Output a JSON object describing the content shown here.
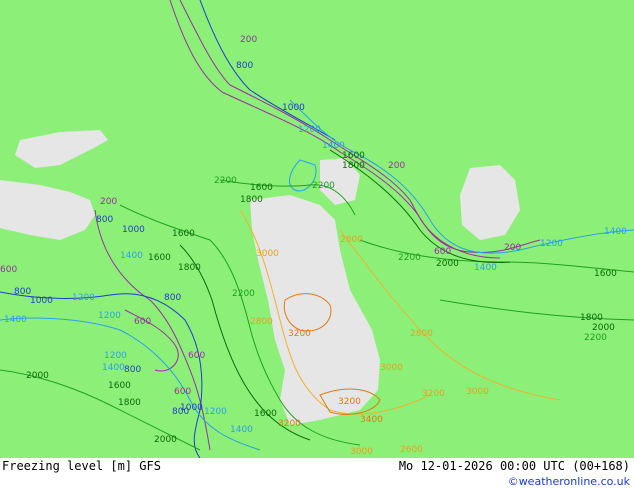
{
  "footer": {
    "title": "Freezing level [m] GFS",
    "datetime": "Mo 12-01-2026 00:00 UTC (00+168)",
    "credit": "©weatheronline.co.uk"
  },
  "colors": {
    "sea": "#8cf078",
    "land": "#e6e6e6",
    "low_contours": "#9a2fa0",
    "mid_contours": "#2aa0e8",
    "green_contours": "#1ea01e",
    "high_contours": "#f0b030"
  },
  "contour_labels": [
    {
      "text": "200",
      "color": "#9a2fa0"
    },
    {
      "text": "600",
      "color": "#9a2fa0"
    },
    {
      "text": "800",
      "color": "#1f3cd0"
    },
    {
      "text": "1000",
      "color": "#1f3cd0"
    },
    {
      "text": "1200",
      "color": "#2aa0e8"
    },
    {
      "text": "1400",
      "color": "#2aa0e8"
    },
    {
      "text": "1600",
      "color": "#0a6a0a"
    },
    {
      "text": "1800",
      "color": "#0a6a0a"
    },
    {
      "text": "2000",
      "color": "#0a6a0a"
    },
    {
      "text": "2200",
      "color": "#1ea01e"
    },
    {
      "text": "2600",
      "color": "#d8c020"
    },
    {
      "text": "2800",
      "color": "#e8a020"
    },
    {
      "text": "3000",
      "color": "#e8a020"
    },
    {
      "text": "3200",
      "color": "#e07a10"
    },
    {
      "text": "3400",
      "color": "#e07a10"
    }
  ]
}
